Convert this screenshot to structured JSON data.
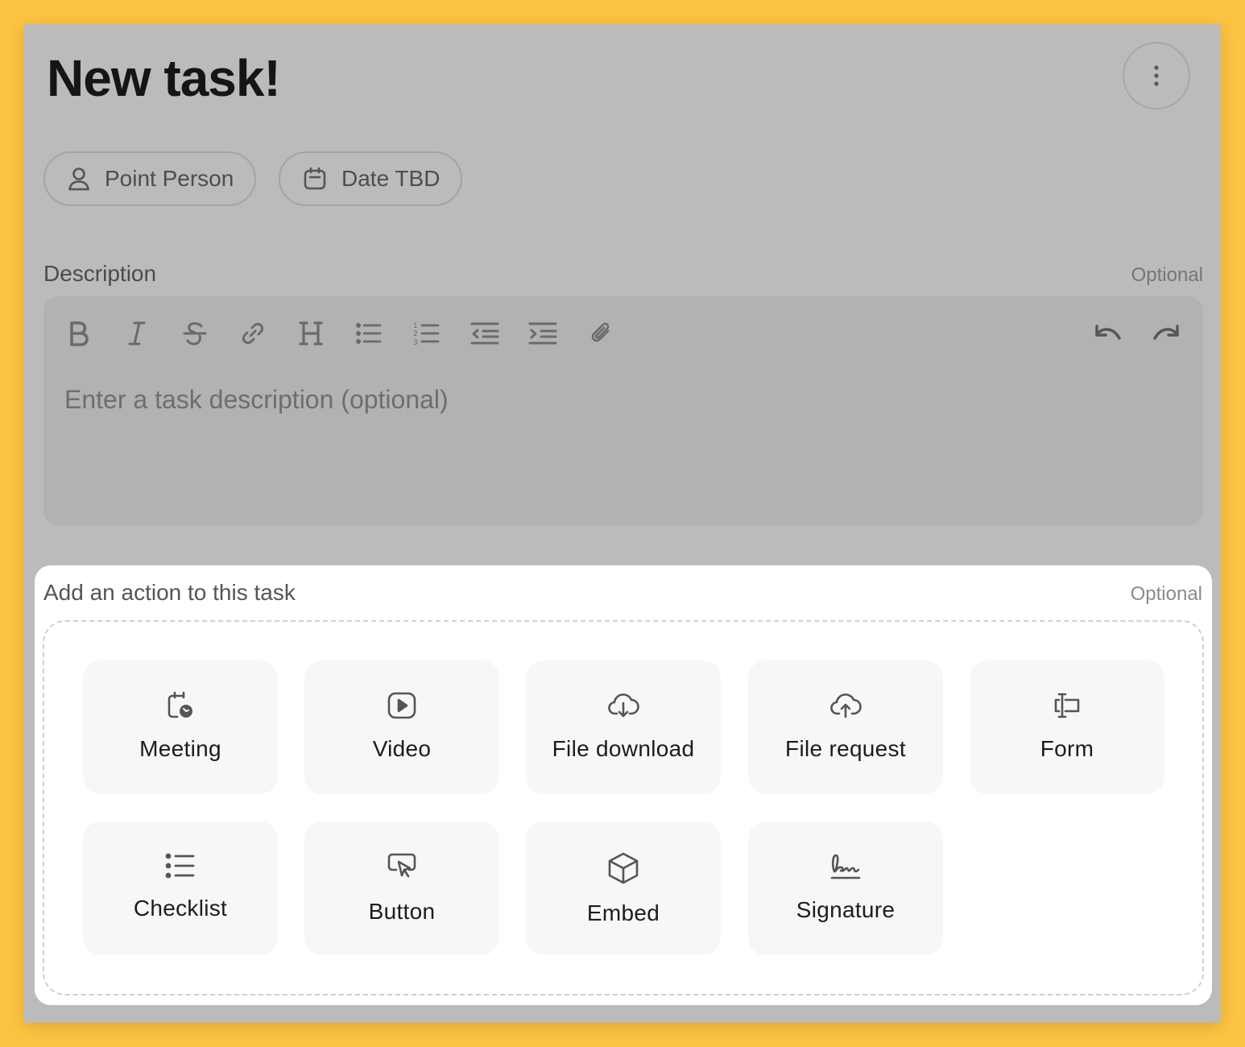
{
  "task": {
    "title": "New task!",
    "more_icon": "vertical-dots-icon",
    "point_person": {
      "label": "Point Person",
      "icon": "user-icon"
    },
    "date": {
      "label": "Date TBD",
      "icon": "calendar-icon"
    }
  },
  "description": {
    "label": "Description",
    "optional": "Optional",
    "placeholder": "Enter a task description (optional)",
    "toolbar": [
      "bold",
      "italic",
      "strikethrough",
      "link",
      "heading",
      "bullet-list",
      "numbered-list",
      "outdent",
      "indent",
      "attachment",
      "undo",
      "redo"
    ]
  },
  "actions": {
    "label": "Add an action to this task",
    "optional": "Optional",
    "items": [
      {
        "label": "Meeting",
        "icon": "meeting-icon"
      },
      {
        "label": "Video",
        "icon": "video-icon"
      },
      {
        "label": "File download",
        "icon": "cloud-download-icon"
      },
      {
        "label": "File request",
        "icon": "cloud-upload-icon"
      },
      {
        "label": "Form",
        "icon": "form-field-icon"
      },
      {
        "label": "Checklist",
        "icon": "checklist-icon"
      },
      {
        "label": "Button",
        "icon": "pointer-button-icon"
      },
      {
        "label": "Embed",
        "icon": "cube-icon"
      },
      {
        "label": "Signature",
        "icon": "signature-icon"
      }
    ]
  },
  "colors": {
    "page_background": "#fdc443",
    "overlay": "#bbbbbb",
    "panel": "#ffffff",
    "tile": "#f6f7f9"
  }
}
